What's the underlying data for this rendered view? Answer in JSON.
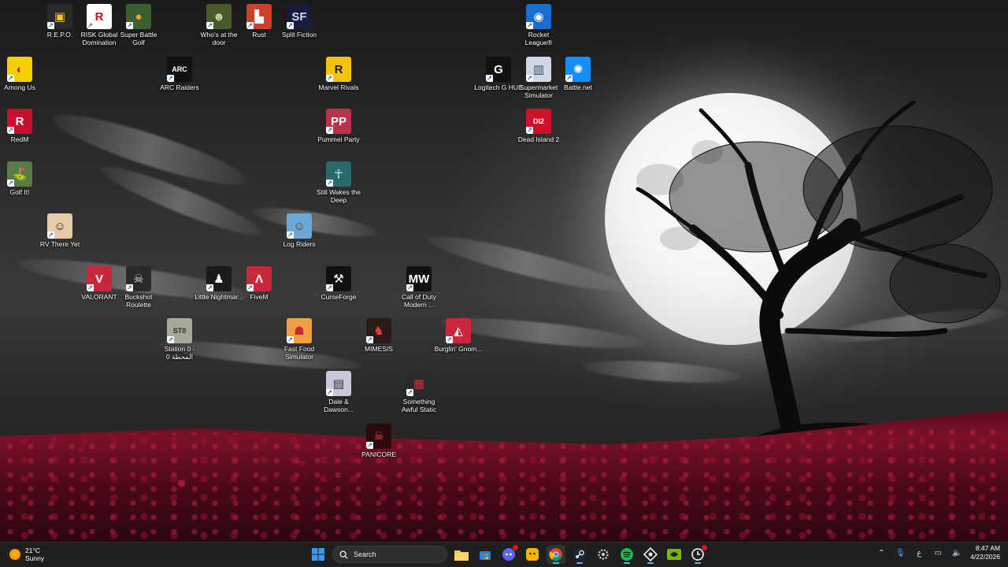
{
  "desktop": {
    "icons": [
      {
        "label": "R.E.P.O.",
        "color": "#2a2a2a",
        "glyph": "▣",
        "fg": "#f3c622"
      },
      {
        "label": "RISK Global Domination",
        "color": "#ffffff",
        "glyph": "R",
        "fg": "#c8102e"
      },
      {
        "label": "Super Battle Golf",
        "color": "#3b5f2e",
        "glyph": "●",
        "fg": "#f0a030"
      },
      {
        "label": "Who's at the door",
        "color": "#4a5a2a",
        "glyph": "☻",
        "fg": "#c9d8a0"
      },
      {
        "label": "Rust",
        "color": "#cd412b",
        "glyph": "▙",
        "fg": "#ffffff"
      },
      {
        "label": "Split Fiction",
        "color": "#1a1a3a",
        "glyph": "SF",
        "fg": "#cfd8ff"
      },
      {
        "label": "Rocket League®",
        "color": "#1b6ed1",
        "glyph": "◉",
        "fg": "#ffffff"
      },
      {
        "label": "Among Us",
        "color": "#f5d000",
        "glyph": "◐",
        "fg": "#c51111"
      },
      {
        "label": "ARC Raiders",
        "color": "#111111",
        "glyph": "ARC",
        "fg": "#ffffff"
      },
      {
        "label": "Marvel Rivals",
        "color": "#f4c20d",
        "glyph": "R",
        "fg": "#1a1a1a"
      },
      {
        "label": "Logitech G HUB",
        "color": "#111111",
        "glyph": "G",
        "fg": "#ffffff"
      },
      {
        "label": "Supermarket Simulator",
        "color": "#cfd6e6",
        "glyph": "▥",
        "fg": "#3a4a6a"
      },
      {
        "label": "Battle.net",
        "color": "#148eff",
        "glyph": "✺",
        "fg": "#ffffff"
      },
      {
        "label": "RedM",
        "color": "#c8102e",
        "glyph": "R",
        "fg": "#ffffff"
      },
      {
        "label": "Pummel Party",
        "color": "#b8324a",
        "glyph": "PP",
        "fg": "#ffffff"
      },
      {
        "label": "Dead Island 2",
        "color": "#d0102a",
        "glyph": "DI2",
        "fg": "#ffffff"
      },
      {
        "label": "Golf It!",
        "color": "#5a7a4a",
        "glyph": "⛳",
        "fg": "#ffffff"
      },
      {
        "label": "Still Wakes the Deep",
        "color": "#2a6a6a",
        "glyph": "☥",
        "fg": "#d8f4f4"
      },
      {
        "label": "RV There Yet",
        "color": "#e8c9a8",
        "glyph": "☺",
        "fg": "#3a2a1a"
      },
      {
        "label": "Log Riders",
        "color": "#6aa8d8",
        "glyph": "☺",
        "fg": "#6a3a1a"
      },
      {
        "label": "VALORANT",
        "color": "#c8283c",
        "glyph": "V",
        "fg": "#ffffff"
      },
      {
        "label": "Buckshot Roulette",
        "color": "#2a2a2a",
        "glyph": "☠",
        "fg": "#d8d8d8"
      },
      {
        "label": "Little Nightmar...",
        "color": "#1a1a1a",
        "glyph": "♟",
        "fg": "#ffffff"
      },
      {
        "label": "FiveM",
        "color": "#c8283c",
        "glyph": "Λ",
        "fg": "#ffffff"
      },
      {
        "label": "CurseForge",
        "color": "#111111",
        "glyph": "⚒",
        "fg": "#ffffff"
      },
      {
        "label": "Call of Duty Modern ...",
        "color": "#111111",
        "glyph": "MW",
        "fg": "#ffffff"
      },
      {
        "label": "Station 0 - المحطة 0",
        "color": "#a8a898",
        "glyph": "ST0",
        "fg": "#2a2a2a"
      },
      {
        "label": "Fast Food Simulator",
        "color": "#f0a040",
        "glyph": "☗",
        "fg": "#c8283c"
      },
      {
        "label": "MIMESIS",
        "color": "#2a1a1a",
        "glyph": "♞",
        "fg": "#e8403a"
      },
      {
        "label": "Burglin' Gnom...",
        "color": "#c8283c",
        "glyph": "◭",
        "fg": "#ffffff"
      },
      {
        "label": "Dale & Dawson...",
        "color": "#c8c8d8",
        "glyph": "▤",
        "fg": "#2a2a3a"
      },
      {
        "label": "Something Awful Static",
        "color": "#2a2a2a",
        "glyph": "▦",
        "fg": "#d8283c"
      },
      {
        "label": "PANICORE",
        "color": "#2a0a0a",
        "glyph": "☠",
        "fg": "#e84848"
      }
    ]
  },
  "taskbar": {
    "weather": {
      "temp": "21°C",
      "condition": "Sunny"
    },
    "search_label": "Search",
    "apps": [
      {
        "name": "start-button",
        "icon": "windows-logo-icon"
      },
      {
        "name": "file-explorer-button",
        "icon": "folder-icon"
      },
      {
        "name": "microsoft-store-button",
        "icon": "store-icon"
      },
      {
        "name": "discord-button",
        "icon": "discord-icon"
      },
      {
        "name": "taskbar-app-yellow-button",
        "icon": "smiley-app-icon"
      },
      {
        "name": "chrome-button",
        "icon": "chrome-icon"
      },
      {
        "name": "steam-button",
        "icon": "steam-icon"
      },
      {
        "name": "settings-button",
        "icon": "gear-icon"
      },
      {
        "name": "spotify-button",
        "icon": "spotify-icon"
      },
      {
        "name": "capture-app-button",
        "icon": "capture-icon"
      },
      {
        "name": "nvidia-button",
        "icon": "nvidia-icon"
      },
      {
        "name": "ghub-button",
        "icon": "ghub-icon"
      }
    ],
    "tray": {
      "language": "ع",
      "time": "8:47 AM",
      "date": "4/22/2026"
    }
  }
}
